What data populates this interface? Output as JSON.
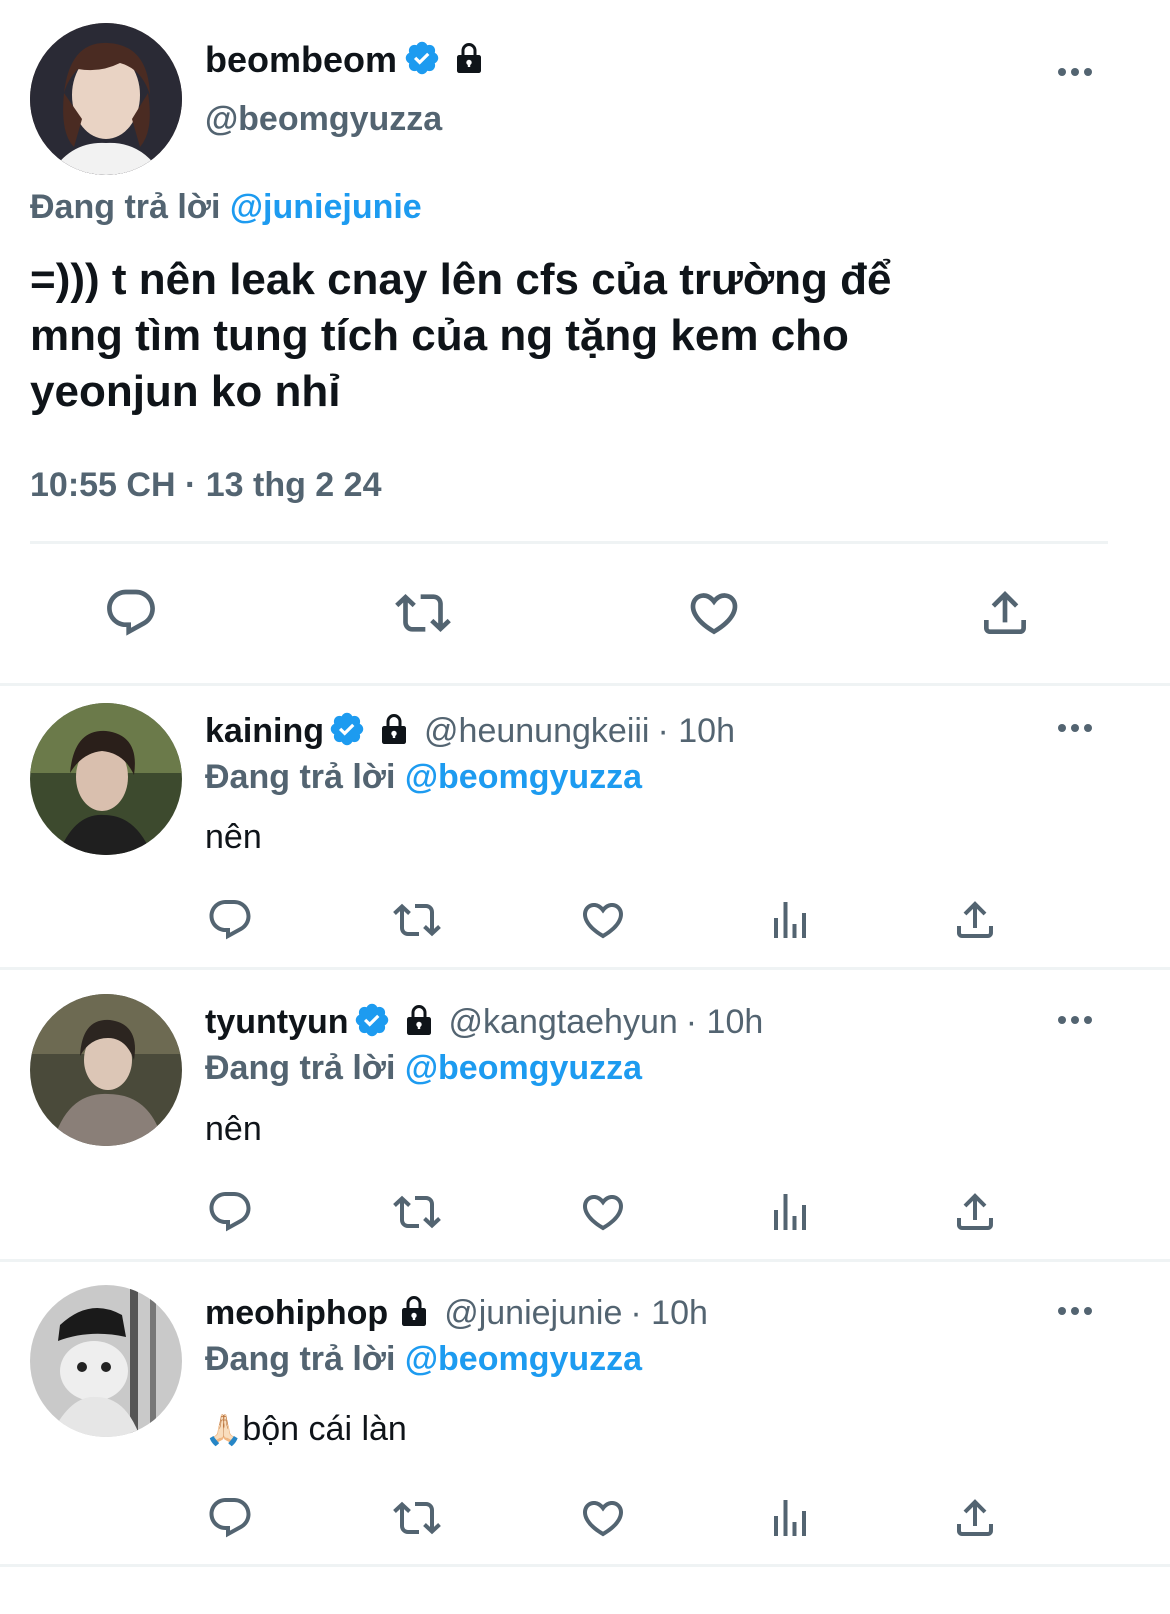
{
  "main_tweet": {
    "display_name": "beombeom",
    "handle": "@beomgyuzza",
    "replying_prefix": "Đang trả lời",
    "replying_to": "@juniejunie",
    "text_line1": "=))) t nên leak cnay lên cfs của trường để",
    "text_line2": "mng tìm tung tích của ng tặng kem cho",
    "text_line3": "yeonjun ko nhỉ",
    "timestamp": "10:55 CH · 13 thg 2 24",
    "avatar_icon": "user-avatar-photo"
  },
  "replies": [
    {
      "display_name": "kaining",
      "handle": "@heunungkeiii",
      "time": "· 10h",
      "replying_prefix": "Đang trả lời",
      "replying_to": "@beomgyuzza",
      "text": "nên",
      "verified": true
    },
    {
      "display_name": "tyuntyun",
      "handle": "@kangtaehyun",
      "time": "· 10h",
      "replying_prefix": "Đang trả lời",
      "replying_to": "@beomgyuzza",
      "text": "nên",
      "verified": true
    },
    {
      "display_name": "meohiphop",
      "handle": "@juniejunie",
      "time": "· 10h",
      "replying_prefix": "Đang trả lời",
      "replying_to": "@beomgyuzza",
      "emoji": "🙏🏻",
      "text": "bộn cái làn",
      "verified": false
    }
  ],
  "colors": {
    "accent_blue": "#1d9bf0",
    "secondary_gray": "#536471",
    "text_primary": "#0f1419",
    "divider": "#eff3f4"
  }
}
